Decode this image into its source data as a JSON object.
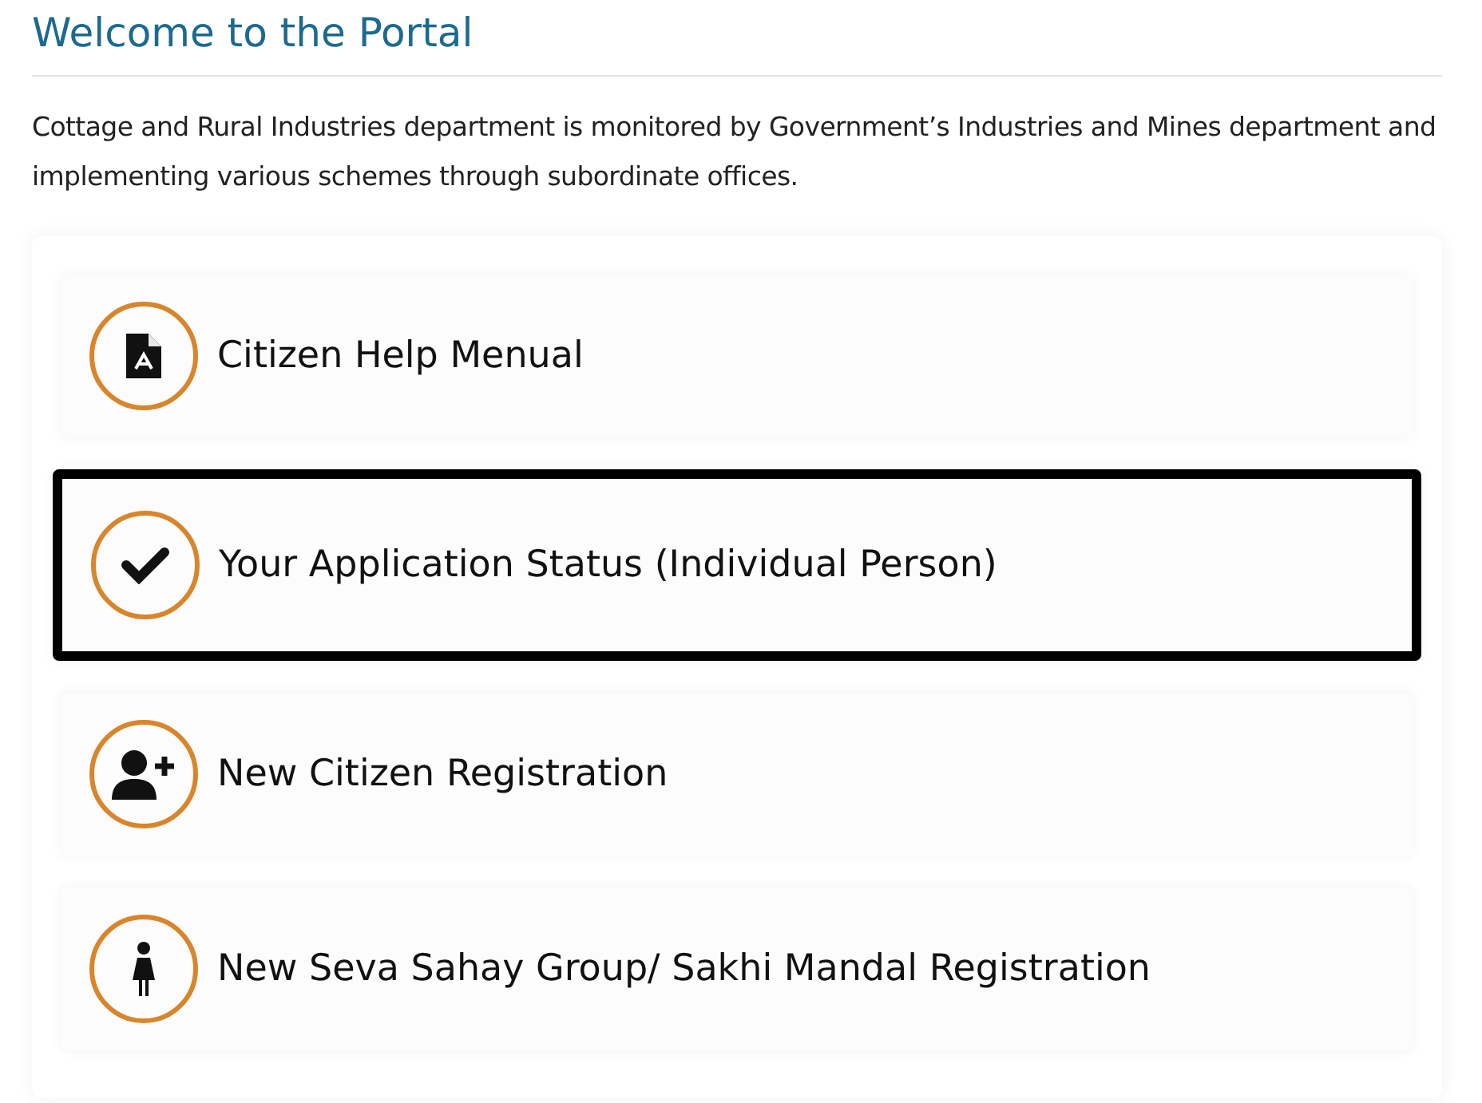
{
  "title": "Welcome to the Portal",
  "intro": "Cottage and Rural Industries department is monitored by Government’s Industries and Mines department and implementing various schemes through subordinate offices.",
  "links": [
    {
      "label": "Citizen Help Menual",
      "kind": "pdf",
      "selected": false
    },
    {
      "label": "Your Application Status (Individual Person)",
      "kind": "check",
      "selected": true
    },
    {
      "label": "New Citizen Registration",
      "kind": "user-add",
      "selected": false
    },
    {
      "label": "New Seva Sahay Group/ Sakhi Mandal Registration",
      "kind": "woman",
      "selected": false
    }
  ]
}
